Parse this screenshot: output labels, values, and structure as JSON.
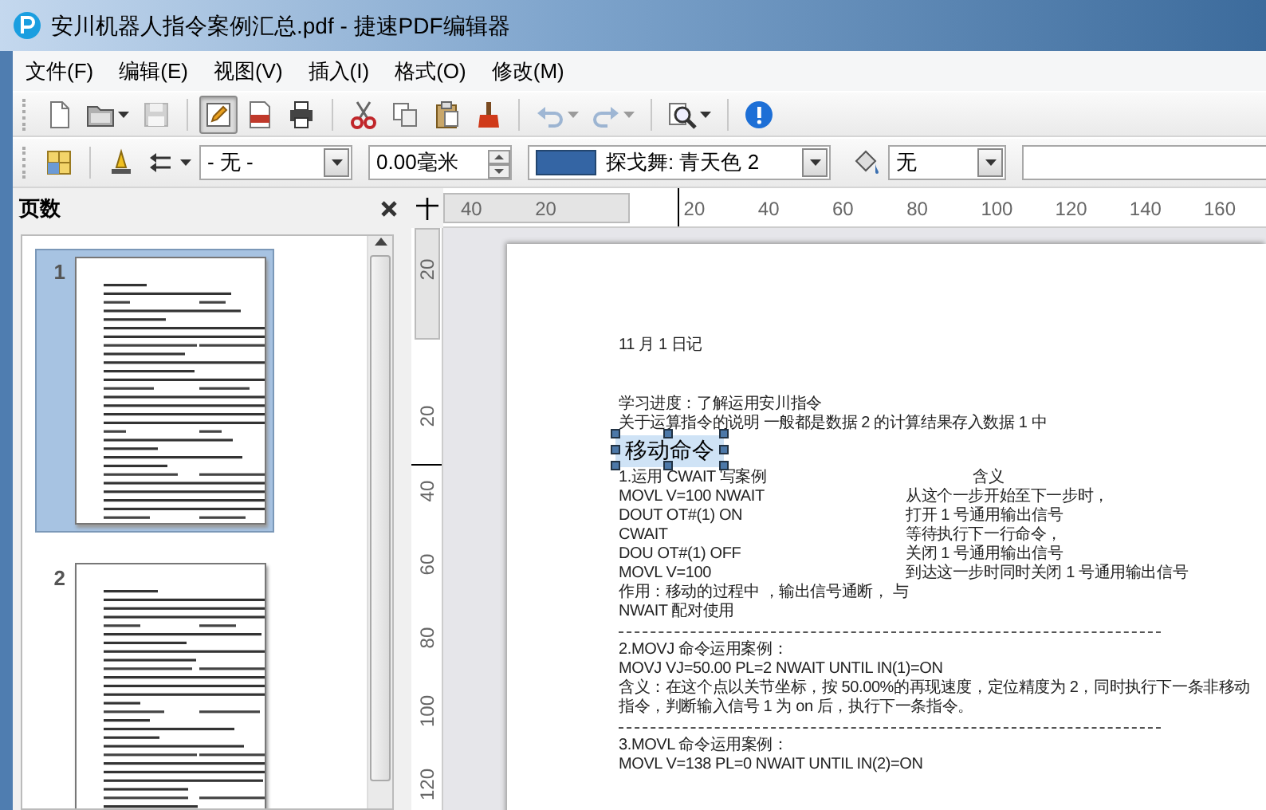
{
  "window": {
    "title": "安川机器人指令案例汇总.pdf - 捷速PDF编辑器"
  },
  "menu": [
    {
      "label": "文件(F)"
    },
    {
      "label": "编辑(E)"
    },
    {
      "label": "视图(V)"
    },
    {
      "label": "插入(I)"
    },
    {
      "label": "格式(O)"
    },
    {
      "label": "修改(M)"
    }
  ],
  "toolbar": {
    "buttons": [
      {
        "kind": "new",
        "pressed": false,
        "disabled": false,
        "dropdown": false
      },
      {
        "kind": "open",
        "pressed": false,
        "disabled": false,
        "dropdown": true
      },
      {
        "kind": "save",
        "pressed": false,
        "disabled": true,
        "dropdown": false
      },
      {
        "kind": "edit",
        "pressed": true,
        "disabled": false,
        "dropdown": false
      },
      {
        "kind": "pdf",
        "pressed": false,
        "disabled": false,
        "dropdown": false
      },
      {
        "kind": "print",
        "pressed": false,
        "disabled": false,
        "dropdown": false
      },
      {
        "kind": "cut",
        "pressed": false,
        "disabled": false,
        "dropdown": false
      },
      {
        "kind": "copy",
        "pressed": false,
        "disabled": false,
        "dropdown": false
      },
      {
        "kind": "paste",
        "pressed": false,
        "disabled": false,
        "dropdown": false
      },
      {
        "kind": "brush",
        "pressed": false,
        "disabled": false,
        "dropdown": false
      },
      {
        "kind": "undo",
        "pressed": false,
        "disabled": true,
        "dropdown": true
      },
      {
        "kind": "redo",
        "pressed": false,
        "disabled": true,
        "dropdown": true
      },
      {
        "kind": "zoom",
        "pressed": false,
        "disabled": false,
        "dropdown": true
      },
      {
        "kind": "info",
        "pressed": false,
        "disabled": false,
        "dropdown": false
      }
    ]
  },
  "format_bar": {
    "line_style": "- 无 -",
    "line_width": "0.00毫米",
    "line_color": {
      "label": "探戈舞: 青天色 2",
      "color": "#3465a4"
    },
    "fill": "无"
  },
  "pages_panel": {
    "title": "页数",
    "pages": [
      {
        "number": "1",
        "selected": true
      },
      {
        "number": "2",
        "selected": false
      }
    ]
  },
  "rulers": {
    "horizontal": [
      "40",
      "20",
      "20",
      "40",
      "60",
      "80",
      "100",
      "120",
      "140",
      "160"
    ],
    "vertical": [
      "20",
      "20",
      "40",
      "60",
      "80",
      "100",
      "120"
    ]
  },
  "document": {
    "lines": [
      {
        "kind": "text",
        "text": "11 月 1 日记"
      },
      {
        "kind": "gap"
      },
      {
        "kind": "text",
        "text": "学习进度：了解运用安川指令"
      },
      {
        "kind": "text",
        "text": "关于运算指令的说明 一般都是数据 2 的计算结果存入数据 1 中"
      },
      {
        "kind": "heading",
        "text": "移动命令",
        "selected": true
      },
      {
        "kind": "pair_header",
        "text": "1.运用 CWAIT 写案例",
        "meaning": "含义"
      },
      {
        "kind": "pair",
        "text": "MOVL V=100 NWAIT",
        "meaning": "从这个一步开始至下一步时，"
      },
      {
        "kind": "pair",
        "text": "DOUT OT#(1) ON",
        "meaning": "打开 1 号通用输出信号"
      },
      {
        "kind": "pair",
        "text": "CWAIT",
        "meaning": "等待执行下一行命令，"
      },
      {
        "kind": "pair",
        "text": "DOU OT#(1) OFF",
        "meaning": "关闭 1 号通用输出信号"
      },
      {
        "kind": "pair",
        "text": "MOVL V=100",
        "meaning": "到达这一步时同时关闭 1 号通用输出信号"
      },
      {
        "kind": "text",
        "text": "作用：移动的过程中 ，输出信号通断， 与"
      },
      {
        "kind": "text",
        "text": "NWAIT 配对使用"
      },
      {
        "kind": "rule"
      },
      {
        "kind": "text",
        "text": "2.MOVJ 命令运用案例："
      },
      {
        "kind": "text",
        "text": "MOVJ  VJ=50.00   PL=2   NWAIT   UNTIL   IN(1)=ON"
      },
      {
        "kind": "text",
        "text": "含义：在这个点以关节坐标，按 50.00%的再现速度，定位精度为 2，同时执行下一条非移动"
      },
      {
        "kind": "text",
        "text": "指令，判断输入信号 1 为 on 后，执行下一条指令。"
      },
      {
        "kind": "rule"
      },
      {
        "kind": "text",
        "text": "3.MOVL 命令运用案例："
      },
      {
        "kind": "text",
        "text": "MOVL   V=138   PL=0   NWAIT   UNTIL   IN(2)=ON"
      }
    ]
  }
}
